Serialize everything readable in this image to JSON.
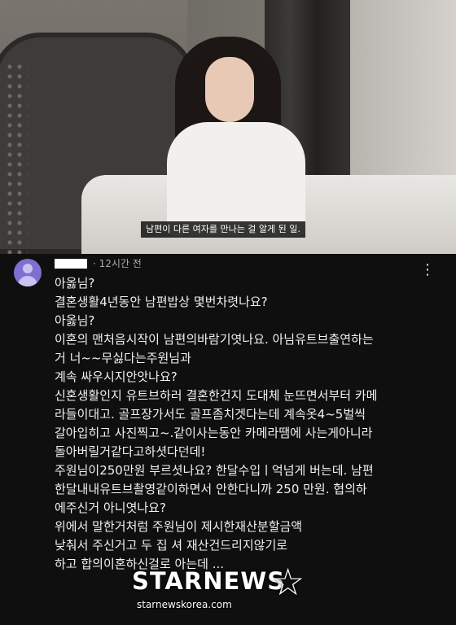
{
  "video": {
    "caption": "남편이 다른 여자를 만나는 걸 알게 된 일."
  },
  "comment": {
    "timestamp": "· 12시간 전",
    "more_icon": "more-vertical-icon",
    "lines": [
      "아옳님?",
      "결혼생활4년동안 남편밥상 몇번차렷나요?",
      "아옳님?",
      "이혼의 맨처음시작이 남편의바람기엿나요. 아님유트브출연하는",
      "거 너~~무싫다는주원님과",
      "계속 싸우시지안앗나요?",
      "신혼생활인지 유트브하러 결혼한건지 도대체 눈뜨면서부터 카메",
      "라들이대고. 골프장가서도 골프좀치겟다는데 계속옷4~5벌씩",
      "갈아입히고 사진찍고~.같이사는동안 카메라땜에  사는게아니라",
      "돌아버릴거같다고하셧다던데!",
      "주원님이250만원 부르셧나요?  한달수입ㅣ억넘게 버는데. 남편",
      "한달내내유트브촬영같이하면서 안한다니까  250 만원. 협의하",
      "에주신거 아니엿나요?",
      "위에서 말한거처럼 주원님이 제시한재산분할금액",
      "낮춰서 주신거고 두   집    셔   재산건드리지않기로",
      "하고 합의이혼하신걸로 아는데 ..."
    ]
  },
  "watermark": {
    "logo": "STARNEWS",
    "site": "starnewskorea.com"
  }
}
